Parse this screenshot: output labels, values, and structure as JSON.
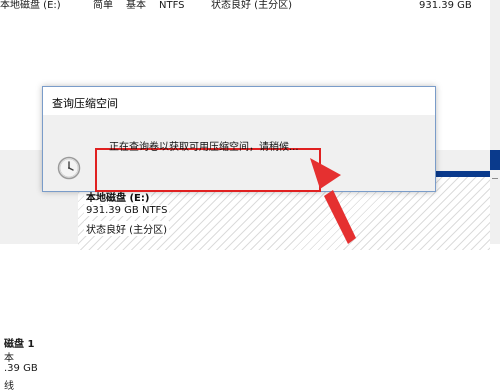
{
  "volume_row": {
    "name": "本地磁盘 (E:)",
    "layout": "简单",
    "type": "基本",
    "filesystem": "NTFS",
    "status": "状态良好 (主分区)",
    "capacity": "931.39 GB"
  },
  "disk": {
    "label": "磁盘 1",
    "type_fragment": "本",
    "size_fragment": ".39 GB",
    "status_fragment": "线"
  },
  "partition": {
    "name": "本地磁盘 (E:)",
    "size_fs": "931.39 GB NTFS",
    "status": "状态良好 (主分区)"
  },
  "dialog": {
    "title": "查询压缩空间",
    "message": "正在查询卷以获取可用压缩空间，请稍候..."
  },
  "icons": {
    "status_icon": "clock-icon",
    "annotation": "red-arrow"
  },
  "colors": {
    "partition_header": "#0a3a8c",
    "highlight": "#e02020"
  }
}
